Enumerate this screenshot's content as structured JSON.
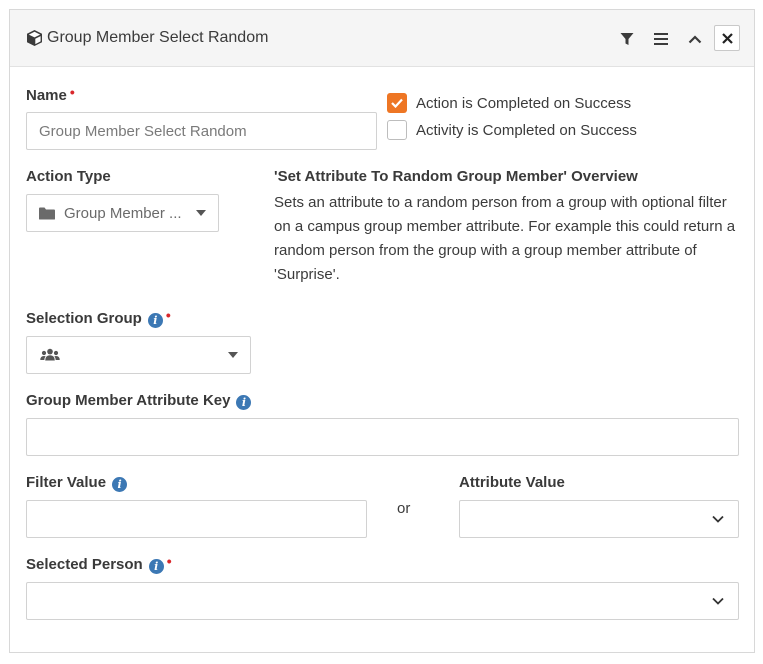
{
  "header": {
    "title": "Group Member Select Random",
    "icon": "cube-icon",
    "buttons": [
      "filter-icon",
      "menu-icon",
      "chevron-up-icon",
      "close-icon"
    ]
  },
  "form": {
    "name": {
      "label": "Name",
      "value": "Group Member Select Random",
      "required_mark": "•"
    },
    "checkboxes": [
      {
        "label": "Action is Completed on Success",
        "checked": true
      },
      {
        "label": "Activity is Completed on Success",
        "checked": false
      }
    ],
    "action_type": {
      "label": "Action Type",
      "value": "Group Member ..."
    },
    "overview": {
      "title": "'Set Attribute To Random Group Member' Overview",
      "body": "Sets an attribute to a random person from a group with optional filter on a campus group member attribute. For example this could return a random person from the group with a group member attribute of 'Surprise'."
    },
    "selection_group": {
      "label": "Selection Group",
      "required_mark": "•",
      "value": ""
    },
    "group_member_attribute_key": {
      "label": "Group Member Attribute Key",
      "value": ""
    },
    "filter_value": {
      "label": "Filter Value",
      "value": ""
    },
    "or_text": "or",
    "attribute_value": {
      "label": "Attribute Value",
      "value": ""
    },
    "selected_person": {
      "label": "Selected Person",
      "required_mark": "•",
      "value": ""
    }
  },
  "colors": {
    "accent": "#ee7624",
    "info": "#3c78b4",
    "required": "#d9272b"
  }
}
